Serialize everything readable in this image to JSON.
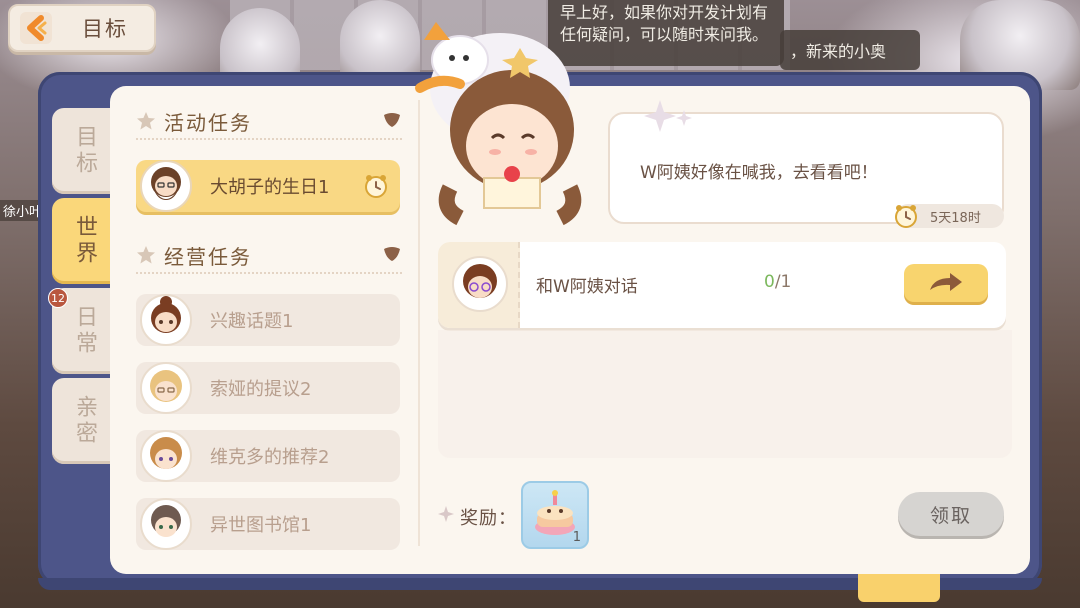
{
  "header": {
    "title": "目标"
  },
  "background": {
    "npc_dialog": "早上好，如果你对开发计划有任何疑问，可以随时来问我。",
    "npc_dialog_2": "，新来的小奥",
    "side_label": "徐小叶"
  },
  "tabs": [
    {
      "label": "目标",
      "active": false
    },
    {
      "label": "世界",
      "active": true
    },
    {
      "label": "日常",
      "active": false,
      "badge": "12"
    },
    {
      "label": "亲密",
      "active": false
    }
  ],
  "sections": {
    "event": {
      "title": "活动任务",
      "items": [
        {
          "label": "大胡子的生日1",
          "active": true,
          "timed": true
        }
      ]
    },
    "business": {
      "title": "经营任务",
      "items": [
        {
          "label": "兴趣话题1"
        },
        {
          "label": "索娅的提议2"
        },
        {
          "label": "维克多的推荐2"
        },
        {
          "label": "异世图书馆1"
        }
      ]
    }
  },
  "detail": {
    "speech": "W阿姨好像在喊我，去看看吧！",
    "timer": "5天18时",
    "objective": {
      "label": "和W阿姨对话",
      "current": "0",
      "total": "/1"
    },
    "reward_label": "奖励：",
    "reward_count": "1",
    "claim_label": "领取"
  },
  "colors": {
    "frame": "#4d5589",
    "panel": "#fbf6ef",
    "accent_yellow": "#f9d884",
    "text_brown": "#6a4b31"
  }
}
